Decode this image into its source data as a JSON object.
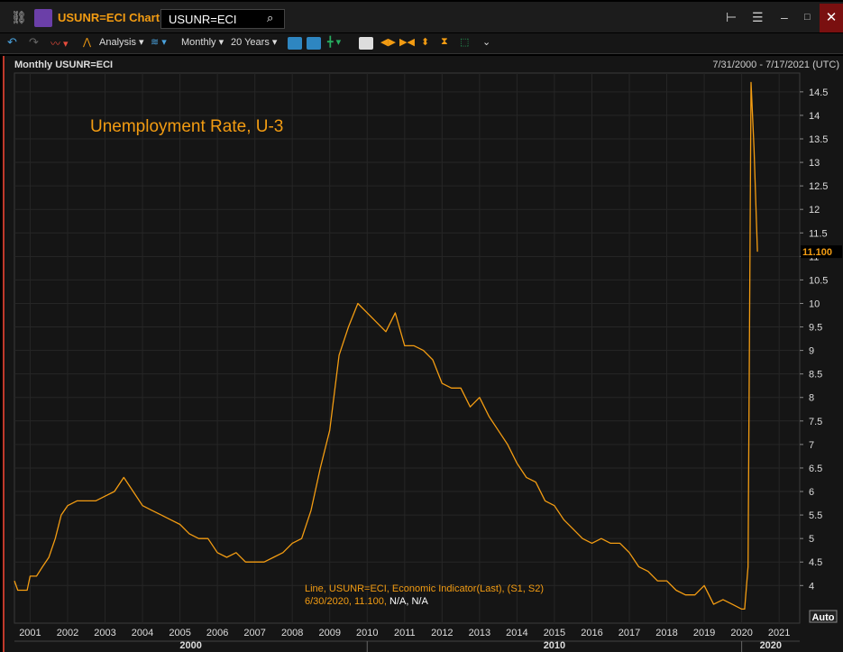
{
  "window": {
    "title": "USUNR=ECI Chart",
    "search_value": "USUNR=ECI",
    "close_glyph": "✕"
  },
  "toolbar": {
    "analysis_label": "Analysis",
    "frequency_label": "Monthly",
    "period_label": "20 Years"
  },
  "chart_header": {
    "left": "Monthly USUNR=ECI",
    "right": "7/31/2000 - 7/17/2021 (UTC)"
  },
  "icons": [
    "link-icon",
    "chart-app-icon",
    "search-icon",
    "tree-icon",
    "menu-icon",
    "minimize-icon",
    "maximize-icon",
    "close-icon",
    "undo-icon",
    "redo-icon",
    "line-style-icon",
    "analysis-icon",
    "wave-icon",
    "chart-type-icon",
    "candle-icon",
    "crosshair-icon",
    "zoom-box-icon",
    "pan-left-right-icon",
    "pan-in-icon",
    "pan-up-down-icon",
    "hourglass-icon",
    "select-icon",
    "more-icon"
  ],
  "colors": {
    "line": "#f39c12",
    "background": "#151515",
    "grid": "#2a2a2a",
    "text": "#dddddd",
    "accent": "#f39c12"
  },
  "chart_data": {
    "type": "line",
    "title": "Unemployment Rate, U-3",
    "series": [
      {
        "values": [
          [
            2000.58,
            4.1
          ],
          [
            2000.67,
            3.9
          ],
          [
            2000.75,
            3.9
          ],
          [
            2000.83,
            3.9
          ],
          [
            2000.92,
            3.9
          ],
          [
            2001.0,
            4.2
          ],
          [
            2001.17,
            4.2
          ],
          [
            2001.33,
            4.4
          ],
          [
            2001.5,
            4.6
          ],
          [
            2001.67,
            5.0
          ],
          [
            2001.83,
            5.5
          ],
          [
            2002.0,
            5.7
          ],
          [
            2002.25,
            5.8
          ],
          [
            2002.5,
            5.8
          ],
          [
            2002.75,
            5.8
          ],
          [
            2003.0,
            5.9
          ],
          [
            2003.25,
            6.0
          ],
          [
            2003.5,
            6.3
          ],
          [
            2003.75,
            6.0
          ],
          [
            2004.0,
            5.7
          ],
          [
            2004.25,
            5.6
          ],
          [
            2004.5,
            5.5
          ],
          [
            2004.75,
            5.4
          ],
          [
            2005.0,
            5.3
          ],
          [
            2005.25,
            5.1
          ],
          [
            2005.5,
            5.0
          ],
          [
            2005.75,
            5.0
          ],
          [
            2006.0,
            4.7
          ],
          [
            2006.25,
            4.6
          ],
          [
            2006.5,
            4.7
          ],
          [
            2006.75,
            4.5
          ],
          [
            2007.0,
            4.5
          ],
          [
            2007.25,
            4.5
          ],
          [
            2007.5,
            4.6
          ],
          [
            2007.75,
            4.7
          ],
          [
            2008.0,
            4.9
          ],
          [
            2008.25,
            5.0
          ],
          [
            2008.5,
            5.6
          ],
          [
            2008.75,
            6.5
          ],
          [
            2009.0,
            7.3
          ],
          [
            2009.25,
            8.9
          ],
          [
            2009.5,
            9.5
          ],
          [
            2009.75,
            10.0
          ],
          [
            2010.0,
            9.8
          ],
          [
            2010.25,
            9.6
          ],
          [
            2010.5,
            9.4
          ],
          [
            2010.75,
            9.8
          ],
          [
            2011.0,
            9.1
          ],
          [
            2011.25,
            9.1
          ],
          [
            2011.5,
            9.0
          ],
          [
            2011.75,
            8.8
          ],
          [
            2012.0,
            8.3
          ],
          [
            2012.25,
            8.2
          ],
          [
            2012.5,
            8.2
          ],
          [
            2012.75,
            7.8
          ],
          [
            2013.0,
            8.0
          ],
          [
            2013.25,
            7.6
          ],
          [
            2013.5,
            7.3
          ],
          [
            2013.75,
            7.0
          ],
          [
            2014.0,
            6.6
          ],
          [
            2014.25,
            6.3
          ],
          [
            2014.5,
            6.2
          ],
          [
            2014.75,
            5.8
          ],
          [
            2015.0,
            5.7
          ],
          [
            2015.25,
            5.4
          ],
          [
            2015.5,
            5.2
          ],
          [
            2015.75,
            5.0
          ],
          [
            2016.0,
            4.9
          ],
          [
            2016.25,
            5.0
          ],
          [
            2016.5,
            4.9
          ],
          [
            2016.75,
            4.9
          ],
          [
            2017.0,
            4.7
          ],
          [
            2017.25,
            4.4
          ],
          [
            2017.5,
            4.3
          ],
          [
            2017.75,
            4.1
          ],
          [
            2018.0,
            4.1
          ],
          [
            2018.25,
            3.9
          ],
          [
            2018.5,
            3.8
          ],
          [
            2018.75,
            3.8
          ],
          [
            2019.0,
            4.0
          ],
          [
            2019.25,
            3.6
          ],
          [
            2019.5,
            3.7
          ],
          [
            2019.75,
            3.6
          ],
          [
            2020.0,
            3.5
          ],
          [
            2020.08,
            3.5
          ],
          [
            2020.17,
            4.4
          ],
          [
            2020.25,
            14.7
          ],
          [
            2020.33,
            13.3
          ],
          [
            2020.42,
            11.1
          ]
        ]
      }
    ],
    "xlim": [
      2000.58,
      2021.55
    ],
    "ylim": [
      3.2,
      14.9
    ],
    "y_ticks": [
      4,
      4.5,
      5,
      5.5,
      6,
      6.5,
      7,
      7.5,
      8,
      8.5,
      9,
      9.5,
      10,
      10.5,
      11,
      11.5,
      12,
      12.5,
      13,
      13.5,
      14,
      14.5
    ],
    "x_ticks": [
      "2001",
      "2002",
      "2003",
      "2004",
      "2005",
      "2006",
      "2007",
      "2008",
      "2009",
      "2010",
      "2011",
      "2012",
      "2013",
      "2014",
      "2015",
      "2016",
      "2017",
      "2018",
      "2019",
      "2020",
      "2021"
    ],
    "decade_labels": [
      "2000",
      "2010",
      "2020"
    ],
    "last_value_label": "11.100",
    "scale_button": "Auto",
    "legend_line1": "Line, USUNR=ECI, Economic Indicator(Last), (S1, S2)",
    "legend_line2_orange": "6/30/2020, 11.100, ",
    "legend_line2_white": "N/A, N/A",
    "grid": true
  }
}
